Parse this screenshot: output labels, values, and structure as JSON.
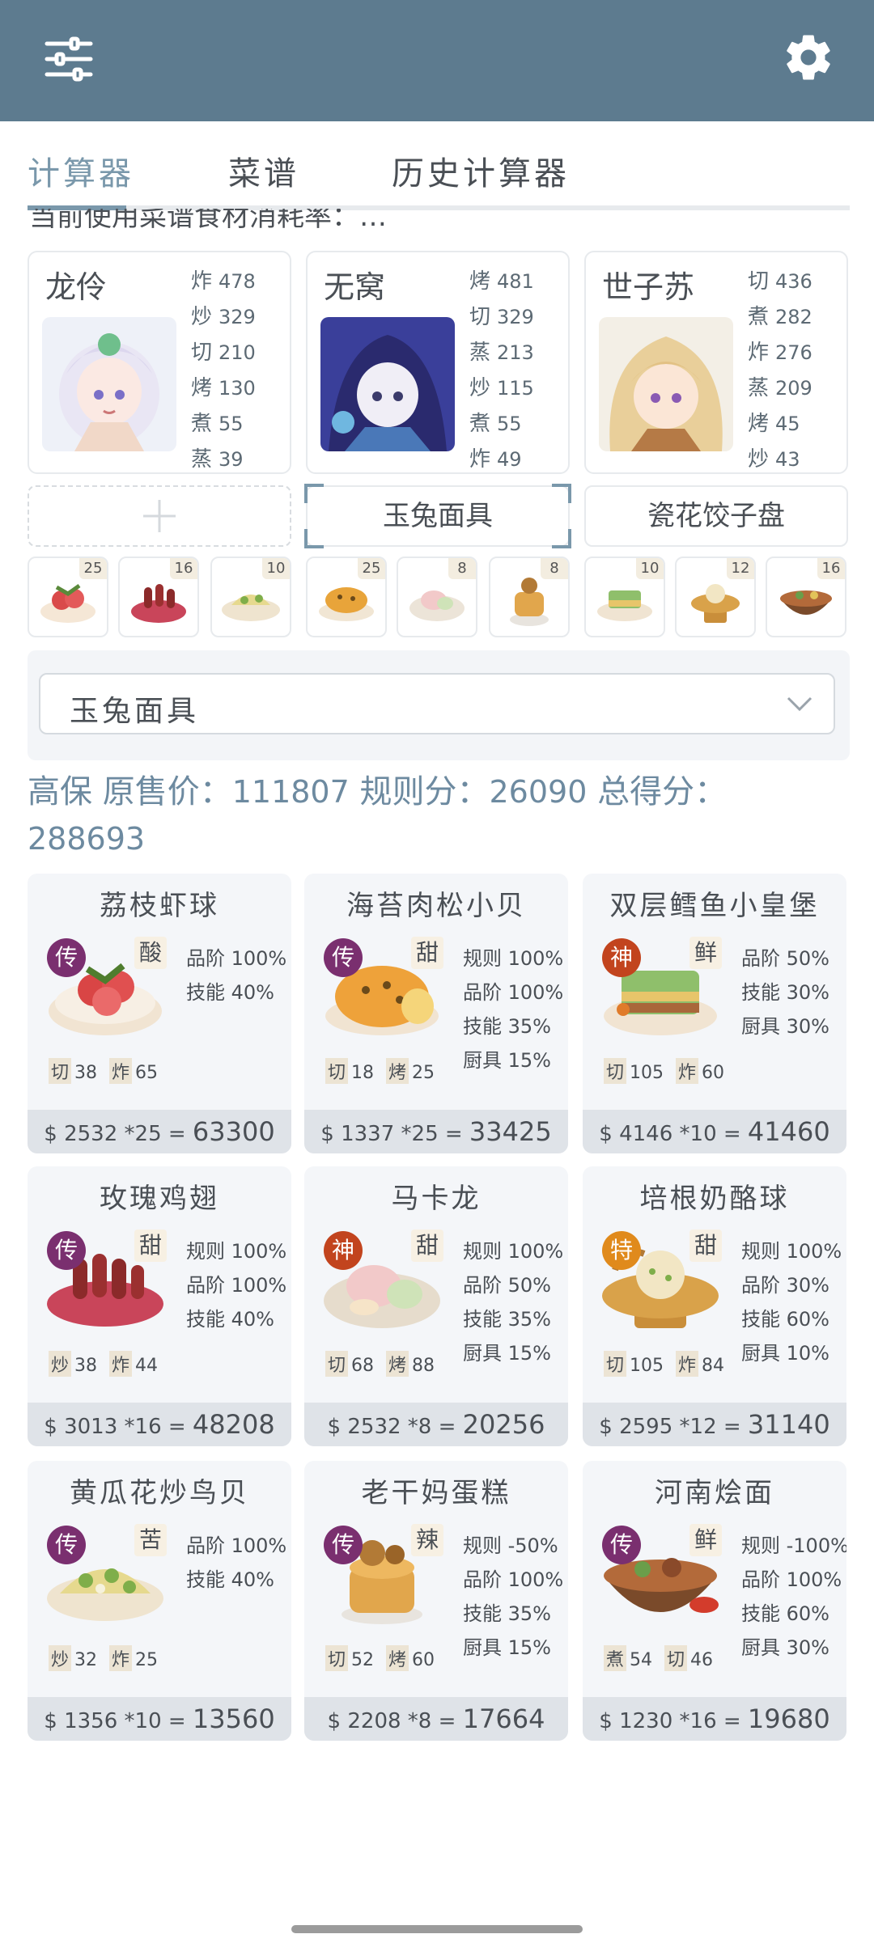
{
  "topbar": {
    "menu_icon": "sliders-icon",
    "settings_icon": "gear-icon"
  },
  "tabs": [
    {
      "label": "计算器",
      "active": true
    },
    {
      "label": "菜谱",
      "active": false
    },
    {
      "label": "历史计算器",
      "active": false
    }
  ],
  "partial_text": "当前使用菜谱食材消耗率：…",
  "chefs": [
    {
      "name": "龙伶",
      "stats": [
        {
          "k": "炸",
          "v": "478"
        },
        {
          "k": "炒",
          "v": "329"
        },
        {
          "k": "切",
          "v": "210"
        },
        {
          "k": "烤",
          "v": "130"
        },
        {
          "k": "煮",
          "v": "55"
        },
        {
          "k": "蒸",
          "v": "39"
        }
      ]
    },
    {
      "name": "无窝",
      "stats": [
        {
          "k": "烤",
          "v": "481"
        },
        {
          "k": "切",
          "v": "329"
        },
        {
          "k": "蒸",
          "v": "213"
        },
        {
          "k": "炒",
          "v": "115"
        },
        {
          "k": "煮",
          "v": "55"
        },
        {
          "k": "炸",
          "v": "49"
        }
      ]
    },
    {
      "name": "世子苏",
      "stats": [
        {
          "k": "切",
          "v": "436"
        },
        {
          "k": "煮",
          "v": "282"
        },
        {
          "k": "炸",
          "v": "276"
        },
        {
          "k": "蒸",
          "v": "209"
        },
        {
          "k": "烤",
          "v": "45"
        },
        {
          "k": "炒",
          "v": "43"
        }
      ]
    }
  ],
  "equip_slots": {
    "add_label": "+",
    "slot2": "玉兔面具",
    "slot3": "瓷花饺子盘"
  },
  "dish_thumbs": [
    "25",
    "16",
    "10",
    "25",
    "8",
    "8",
    "10",
    "12",
    "16"
  ],
  "selector": {
    "value": "玉兔面具"
  },
  "summary": {
    "prefix": "高保 原售价：",
    "original_price": "111807",
    "rule_label": " 规则分：",
    "rule_score": "26090",
    "total_label": " 总得分：",
    "total_score": "288693"
  },
  "dishes": [
    {
      "name": "荔枝虾球",
      "rarity": "传",
      "flavor": "酸",
      "bonus": [
        "品阶 100%",
        "技能 40%"
      ],
      "reqs": [
        {
          "k": "切",
          "v": "38"
        },
        {
          "k": "炸",
          "v": "65"
        }
      ],
      "price": "$ 2532 *25 = ",
      "total": "63300"
    },
    {
      "name": "海苔肉松小贝",
      "rarity": "传",
      "flavor": "甜",
      "bonus": [
        "规则 100%",
        "品阶 100%",
        "技能 35%",
        "厨具 15%"
      ],
      "reqs": [
        {
          "k": "切",
          "v": "18"
        },
        {
          "k": "烤",
          "v": "25"
        }
      ],
      "price": "$ 1337 *25 = ",
      "total": "33425"
    },
    {
      "name": "双层鳕鱼小皇堡",
      "rarity": "神",
      "flavor": "鲜",
      "bonus": [
        "品阶 50%",
        "技能 30%",
        "厨具 30%"
      ],
      "reqs": [
        {
          "k": "切",
          "v": "105"
        },
        {
          "k": "炸",
          "v": "60"
        }
      ],
      "price": "$ 4146 *10 = ",
      "total": "41460"
    },
    {
      "name": "玫瑰鸡翅",
      "rarity": "传",
      "flavor": "甜",
      "bonus": [
        "规则 100%",
        "品阶 100%",
        "技能 40%"
      ],
      "reqs": [
        {
          "k": "炒",
          "v": "38"
        },
        {
          "k": "炸",
          "v": "44"
        }
      ],
      "price": "$ 3013 *16 = ",
      "total": "48208"
    },
    {
      "name": "马卡龙",
      "rarity": "神",
      "flavor": "甜",
      "bonus": [
        "规则 100%",
        "品阶 50%",
        "技能 35%",
        "厨具 15%"
      ],
      "reqs": [
        {
          "k": "切",
          "v": "68"
        },
        {
          "k": "烤",
          "v": "88"
        }
      ],
      "price": "$ 2532 *8 = ",
      "total": "20256"
    },
    {
      "name": "培根奶酪球",
      "rarity": "特",
      "flavor": "甜",
      "bonus": [
        "规则 100%",
        "品阶 30%",
        "技能 60%",
        "厨具 10%"
      ],
      "reqs": [
        {
          "k": "切",
          "v": "105"
        },
        {
          "k": "炸",
          "v": "84"
        }
      ],
      "price": "$ 2595 *12 = ",
      "total": "31140"
    },
    {
      "name": "黄瓜花炒鸟贝",
      "rarity": "传",
      "flavor": "苦",
      "bonus": [
        "品阶 100%",
        "技能 40%"
      ],
      "reqs": [
        {
          "k": "炒",
          "v": "32"
        },
        {
          "k": "炸",
          "v": "25"
        }
      ],
      "price": "$ 1356 *10 = ",
      "total": "13560"
    },
    {
      "name": "老干妈蛋糕",
      "rarity": "传",
      "flavor": "辣",
      "bonus": [
        "规则 -50%",
        "品阶 100%",
        "技能 35%",
        "厨具 15%"
      ],
      "reqs": [
        {
          "k": "切",
          "v": "52"
        },
        {
          "k": "烤",
          "v": "60"
        }
      ],
      "price": "$ 2208 *8 = ",
      "total": "17664"
    },
    {
      "name": "河南烩面",
      "rarity": "传",
      "flavor": "鲜",
      "bonus": [
        "规则 -100%",
        "品阶 100%",
        "技能 60%",
        "厨具 30%"
      ],
      "reqs": [
        {
          "k": "煮",
          "v": "54"
        },
        {
          "k": "切",
          "v": "46"
        }
      ],
      "price": "$ 1230 *16 = ",
      "total": "19680"
    }
  ],
  "colors": {
    "header": "#5d7b8f",
    "accent": "#7a98ab",
    "rarity_legend": "#7a2f6f",
    "rarity_god": "#c2441e",
    "rarity_special": "#e08a1c"
  }
}
